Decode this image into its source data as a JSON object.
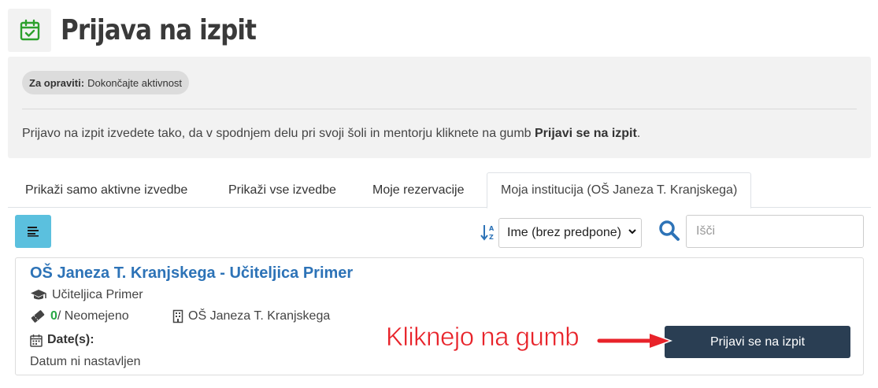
{
  "header": {
    "title": "Prijava na izpit",
    "icon": "calendar-check-icon",
    "icon_color": "#2ca02c"
  },
  "info": {
    "todo_label": "Za opraviti:",
    "todo_value": "Dokončajte aktivnost",
    "text_before": "Prijavo na izpit izvedete tako, da v spodnjem delu pri svoji šoli in mentorju kliknete na gumb ",
    "text_bold": "Prijavi se na izpit",
    "text_after": "."
  },
  "tabs": [
    {
      "label": "Prikaži samo aktivne izvedbe"
    },
    {
      "label": "Prikaži vse izvedbe"
    },
    {
      "label": "Moje rezervacije"
    },
    {
      "label": "Moja institucija (OŠ Janeza T. Kranjskega)",
      "active": true
    }
  ],
  "toolbar": {
    "sort_selected": "Ime (brez predpone)",
    "search_placeholder": "Išči",
    "list_button_color": "#5bc0de"
  },
  "card": {
    "title": "OŠ Janeza T. Kranjskega - Učiteljica Primer",
    "teacher": "Učiteljica Primer",
    "count": "0",
    "count_suffix": " / Neomejeno",
    "institution": "OŠ Janeza T. Kranjskega",
    "dates_label": "Date(s):",
    "dates_value": "Datum ni nastavljen",
    "register_button": "Prijavi se na izpit",
    "register_button_color": "#2a3e53"
  },
  "annotation": {
    "text": "Kliknejo na gumb",
    "color": "#e8232a"
  }
}
